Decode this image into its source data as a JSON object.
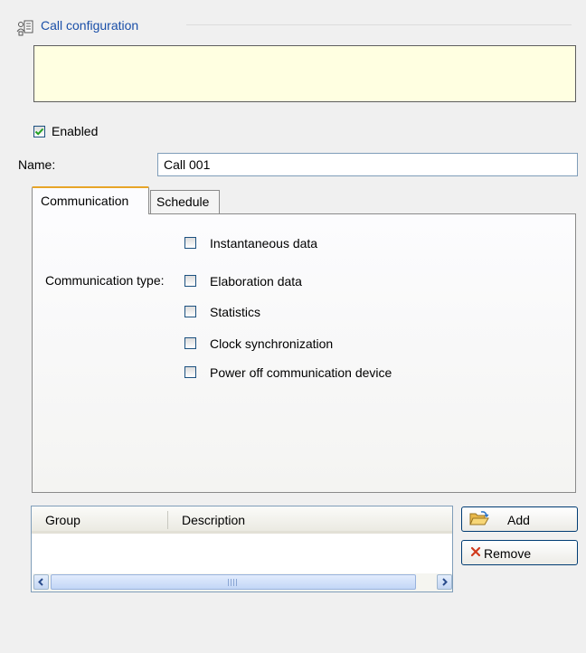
{
  "header": {
    "title": "Call configuration",
    "icon": "call-config-icon"
  },
  "message_box": {
    "text": "",
    "background": "#ffffe1"
  },
  "enabled": {
    "label": "Enabled",
    "checked": true
  },
  "name": {
    "label": "Name:",
    "value": "Call 001"
  },
  "tabs": [
    {
      "label": "Communication",
      "active": true
    },
    {
      "label": "Schedule",
      "active": false
    }
  ],
  "communication": {
    "type_label": "Communication type:",
    "options": [
      {
        "label": "Instantaneous data",
        "checked": false
      },
      {
        "label": "Elaboration data",
        "checked": false
      },
      {
        "label": "Statistics",
        "checked": false
      },
      {
        "label": "Clock synchronization",
        "checked": false
      },
      {
        "label": "Power off communication device",
        "checked": false
      }
    ]
  },
  "grid": {
    "columns": [
      "Group",
      "Description"
    ],
    "rows": []
  },
  "buttons": {
    "add_label": "Add",
    "remove_label": "Remove"
  },
  "colors": {
    "accent": "#1a4fa8",
    "tab_highlight": "#e7a528",
    "remove_x": "#d03a1c"
  }
}
